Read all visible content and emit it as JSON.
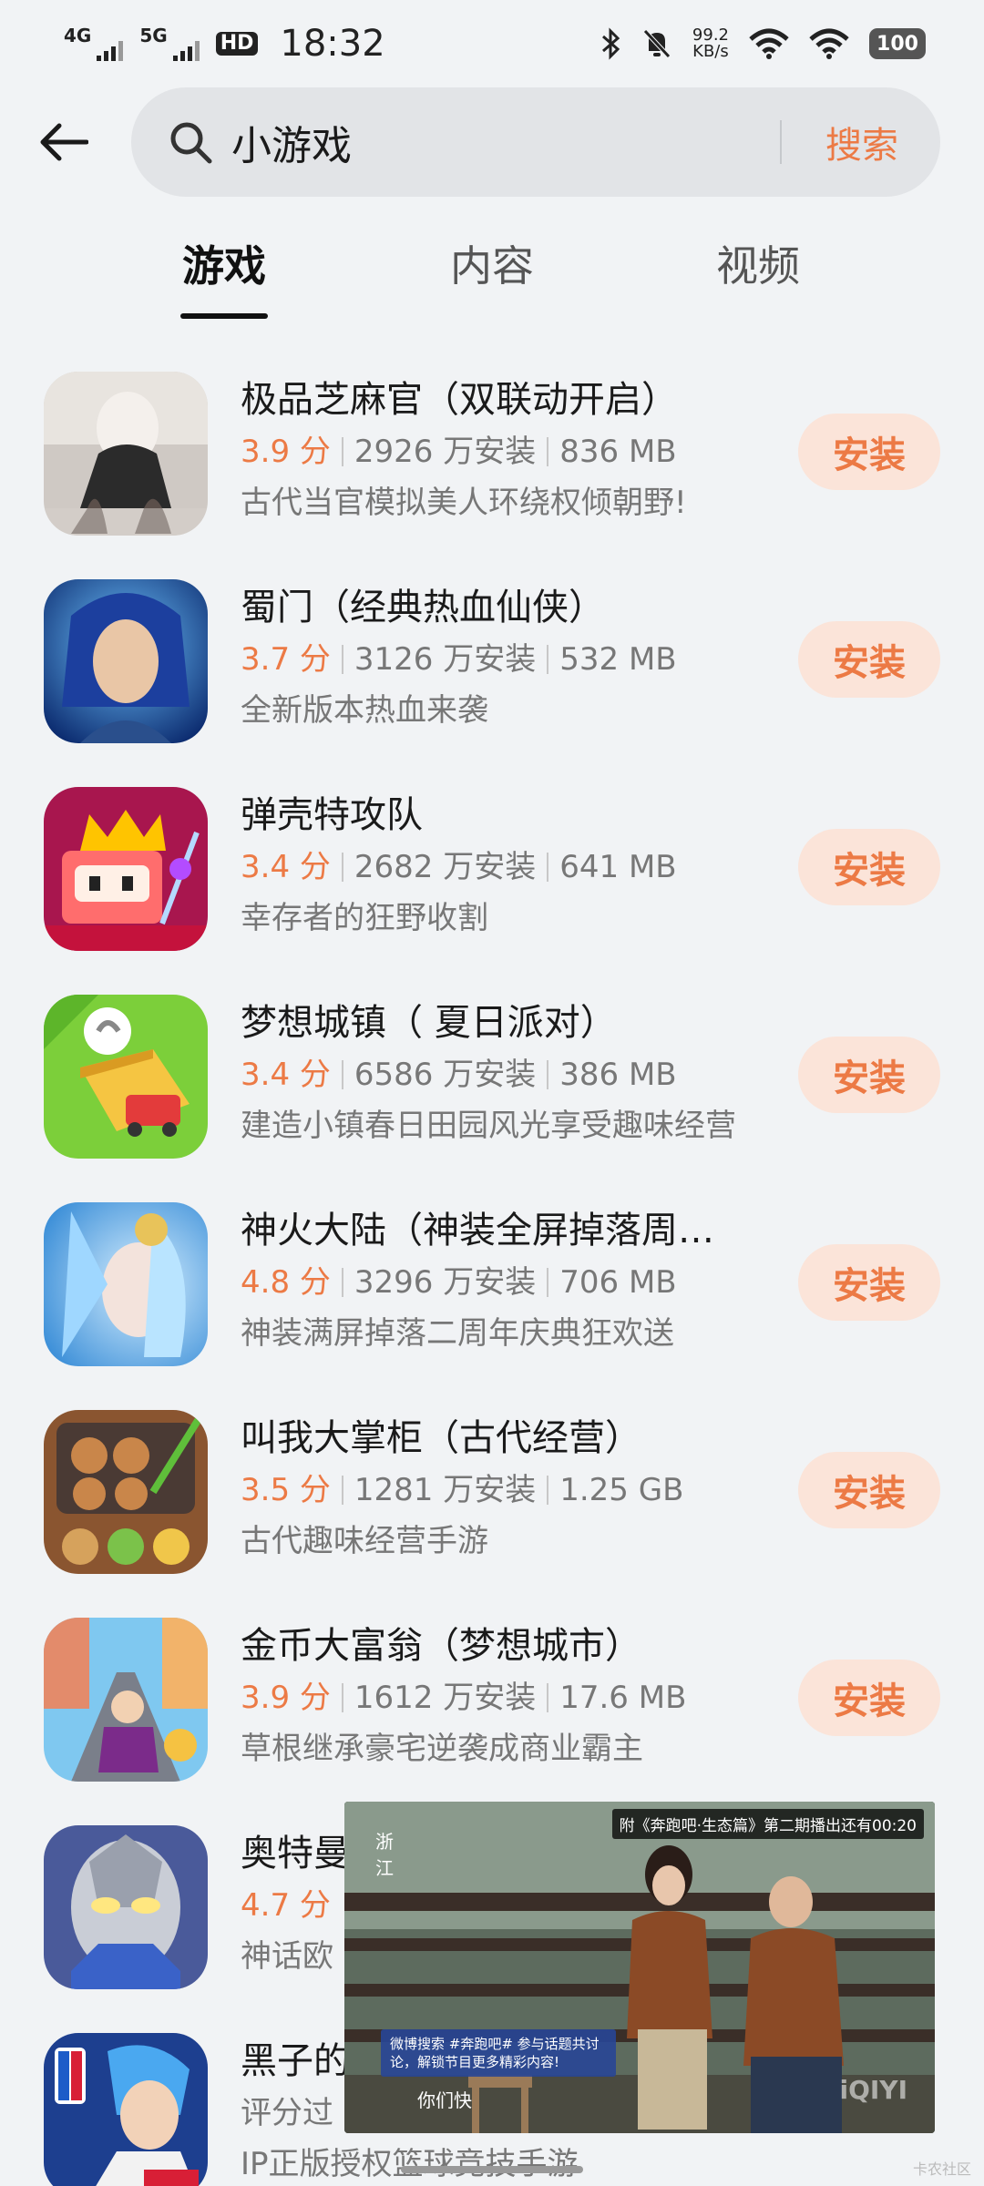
{
  "status_bar": {
    "net1": "4G",
    "net2": "5G",
    "hd": "HD",
    "time": "18:32",
    "speed_value": "99.2",
    "speed_unit": "KB/s",
    "battery": "100"
  },
  "search": {
    "query": "小游戏",
    "button": "搜索"
  },
  "tabs": [
    {
      "label": "游戏",
      "active": true
    },
    {
      "label": "内容",
      "active": false
    },
    {
      "label": "视频",
      "active": false
    }
  ],
  "apps": [
    {
      "name": "极品芝麻官（双联动开启）",
      "rating": "3.9 分",
      "installs": "2926 万安装",
      "size": "836 MB",
      "desc": "古代当官模拟美人环绕权倾朝野!",
      "button": "安装"
    },
    {
      "name": "蜀门（经典热血仙侠）",
      "rating": "3.7 分",
      "installs": "3126 万安装",
      "size": "532 MB",
      "desc": "全新版本热血来袭",
      "button": "安装"
    },
    {
      "name": "弹壳特攻队",
      "rating": "3.4 分",
      "installs": "2682 万安装",
      "size": "641 MB",
      "desc": "幸存者的狂野收割",
      "button": "安装"
    },
    {
      "name": "梦想城镇（ 夏日派对）",
      "rating": "3.4 分",
      "installs": "6586 万安装",
      "size": "386 MB",
      "desc": "建造小镇春日田园风光享受趣味经营",
      "button": "安装"
    },
    {
      "name": "神火大陆（神装全屏掉落周…",
      "rating": "4.8 分",
      "installs": "3296 万安装",
      "size": "706 MB",
      "desc": "神装满屏掉落二周年庆典狂欢送",
      "button": "安装"
    },
    {
      "name": "叫我大掌柜（古代经营）",
      "rating": "3.5 分",
      "installs": "1281 万安装",
      "size": "1.25 GB",
      "desc": "古代趣味经营手游",
      "button": "安装"
    },
    {
      "name": "金币大富翁（梦想城市）",
      "rating": "3.9 分",
      "installs": "1612 万安装",
      "size": "17.6 MB",
      "desc": "草根继承豪宅逆袭成商业霸主",
      "button": "安装"
    },
    {
      "name": "奥特曼",
      "rating": "4.7 分",
      "installs": "",
      "size": "",
      "desc": "神话欧",
      "button": ""
    },
    {
      "name": "黑子的",
      "rating": "评分过",
      "installs": "",
      "size": "",
      "desc": "IP正版授权篮球竞技手游",
      "button": ""
    }
  ],
  "video": {
    "top_caption": "附《奔跑吧·生态篇》第二期播出还有00:20",
    "bottom_caption": "微博搜索 #奔跑吧# 参与话题共讨论，解锁节目更多精彩内容!",
    "subtitle": "你们快",
    "watermark": "iQIYI",
    "channel_logo": "浙江"
  },
  "corner_mark": "卡农社区",
  "icons": {
    "back": "arrow-left-icon",
    "search": "magnifier-icon"
  },
  "colors": {
    "accent": "#ec7a45",
    "install_bg": "#fbe4d9",
    "background": "#f1f3f5"
  }
}
